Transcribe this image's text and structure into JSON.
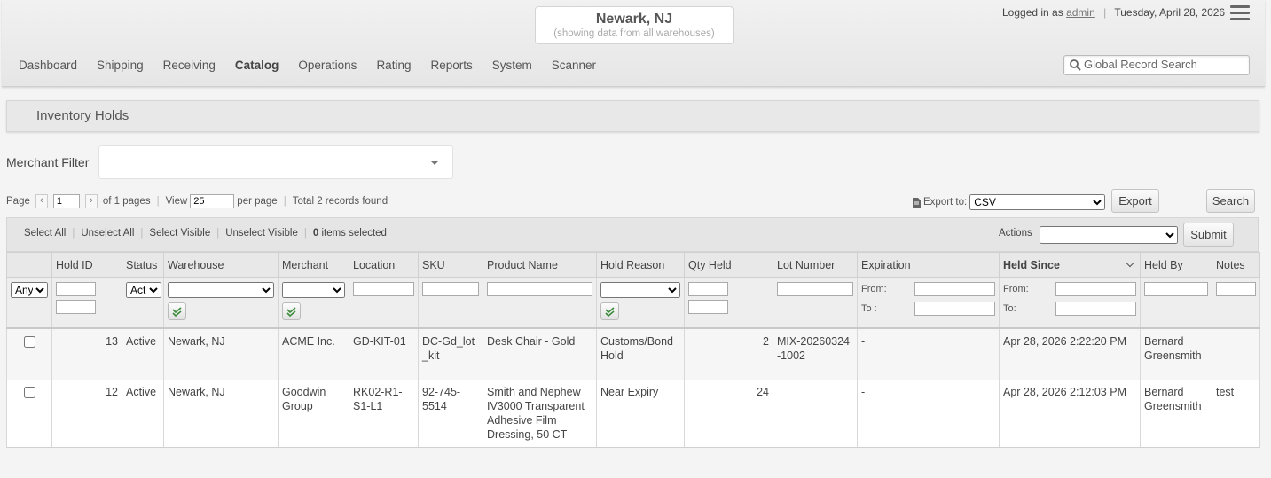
{
  "header": {
    "warehouse_title": "Newark, NJ",
    "warehouse_subtitle": "(showing data from all warehouses)",
    "logged_in_prefix": "Logged in as",
    "user": "admin",
    "date": "Tuesday, April 28, 2026",
    "search_placeholder": "Global Record Search"
  },
  "nav": [
    {
      "label": "Dashboard"
    },
    {
      "label": "Shipping"
    },
    {
      "label": "Receiving"
    },
    {
      "label": "Catalog",
      "active": true
    },
    {
      "label": "Operations"
    },
    {
      "label": "Rating"
    },
    {
      "label": "Reports"
    },
    {
      "label": "System"
    },
    {
      "label": "Scanner"
    }
  ],
  "page_title": "Inventory Holds",
  "merchant_filter": {
    "label": "Merchant Filter",
    "value": ""
  },
  "pager": {
    "page_label": "Page",
    "page": "1",
    "of_pages": "of 1 pages",
    "view_label": "View",
    "per_page": "25",
    "per_page_label": "per page",
    "total": "Total 2 records found"
  },
  "export": {
    "label": "Export to:",
    "format": "CSV",
    "button": "Export"
  },
  "search_button": "Search",
  "actions_bar": {
    "select_all": "Select All",
    "unselect_all": "Unselect All",
    "select_visible": "Select Visible",
    "unselect_visible": "Unselect Visible",
    "selected_count": "0",
    "selected_suffix": "items selected",
    "actions_label": "Actions",
    "submit": "Submit"
  },
  "columns": [
    "",
    "Hold ID",
    "Status",
    "Warehouse",
    "Merchant",
    "Location",
    "SKU",
    "Product Name",
    "Hold Reason",
    "Qty Held",
    "Lot Number",
    "Expiration",
    "Held Since",
    "Held By",
    "Notes"
  ],
  "filters": {
    "checkbox_any": "Any",
    "status": "Active",
    "from_label": "From:",
    "to_label_exp": "To :",
    "to_label_held": "To:"
  },
  "rows": [
    {
      "hold_id": "13",
      "status": "Active",
      "warehouse": "Newark, NJ",
      "merchant": "ACME Inc.",
      "location": "GD-KIT-01",
      "sku": "DC-Gd_lot_kit",
      "product": "Desk Chair - Gold",
      "reason": "Customs/Bond Hold",
      "qty": "2",
      "lot": "MIX-20260324-1002",
      "expiration": "-",
      "held_since": "Apr 28, 2026 2:22:20 PM",
      "held_by": "Bernard Greensmith",
      "notes": ""
    },
    {
      "hold_id": "12",
      "status": "Active",
      "warehouse": "Newark, NJ",
      "merchant": "Goodwin Group",
      "location": "RK02-R1-S1-L1",
      "sku": "92-745-5514",
      "product": "Smith and Nephew IV3000 Transparent Adhesive Film Dressing, 50 CT",
      "reason": "Near Expiry",
      "qty": "24",
      "lot": "",
      "expiration": "-",
      "held_since": "Apr 28, 2026 2:12:03 PM",
      "held_by": "Bernard Greensmith",
      "notes": "test"
    }
  ]
}
